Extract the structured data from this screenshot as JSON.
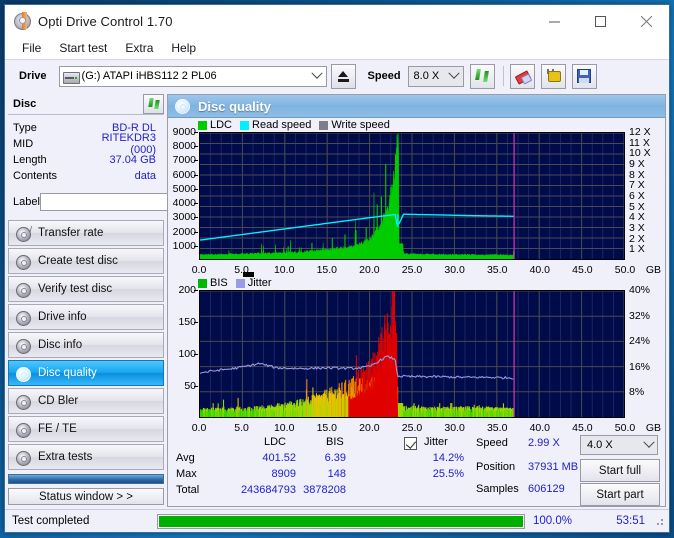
{
  "window": {
    "title": "Opti Drive Control 1.70",
    "app_icon": "disc-icon",
    "minimize": "minimize-icon",
    "maximize": "maximize-icon",
    "close": "close-icon"
  },
  "menu": {
    "items": [
      {
        "label": "File"
      },
      {
        "label": "Start test"
      },
      {
        "label": "Extra"
      },
      {
        "label": "Help"
      }
    ]
  },
  "toolbar": {
    "drive_label": "Drive",
    "drive_value": "(G:)  ATAPI iHBS112  2 PL06",
    "eject_icon": "eject-icon",
    "speed_label": "Speed",
    "speed_value": "8.0 X",
    "refresh_icon": "refresh-icon",
    "eraser_icon": "eraser-icon",
    "plug_icon": "plug-icon",
    "save_icon": "save-icon"
  },
  "disc": {
    "header": "Disc",
    "refresh_icon": "refresh-icon",
    "rows": [
      {
        "key": "Type",
        "value": "BD-R DL"
      },
      {
        "key": "MID",
        "value": "RITEKDR3 (000)"
      },
      {
        "key": "Length",
        "value": "37.04 GB"
      },
      {
        "key": "Contents",
        "value": "data"
      }
    ],
    "label_key": "Label",
    "label_value": "",
    "label_button_icon": "cd-icon"
  },
  "nav": {
    "items": [
      {
        "label": "Transfer rate",
        "icon": "disc-rate-icon",
        "selected": false
      },
      {
        "label": "Create test disc",
        "icon": "disc-create-icon",
        "selected": false
      },
      {
        "label": "Verify test disc",
        "icon": "disc-verify-icon",
        "selected": false
      },
      {
        "label": "Drive info",
        "icon": "disc-drive-icon",
        "selected": false
      },
      {
        "label": "Disc info",
        "icon": "disc-info-icon",
        "selected": false
      },
      {
        "label": "Disc quality",
        "icon": "disc-quality-icon",
        "selected": true
      },
      {
        "label": "CD Bler",
        "icon": "disc-bler-icon",
        "selected": false
      },
      {
        "label": "FE / TE",
        "icon": "disc-fete-icon",
        "selected": false
      },
      {
        "label": "Extra tests",
        "icon": "disc-extra-icon",
        "selected": false
      }
    ],
    "status_window_button": "Status window > >"
  },
  "panel": {
    "title": "Disc quality",
    "icon": "disc-quality-icon"
  },
  "stats": {
    "col_ldc": "LDC",
    "col_bis": "BIS",
    "row_avg": "Avg",
    "row_max": "Max",
    "row_total": "Total",
    "ldc_avg": "401.52",
    "ldc_max": "8909",
    "ldc_total": "243684793",
    "bis_avg": "6.39",
    "bis_max": "148",
    "bis_total": "3878208",
    "jitter_label": "Jitter",
    "jitter_checked": true,
    "jitter_avg": "14.2%",
    "jitter_max": "25.5%",
    "speed_label": "Speed",
    "speed_value": "2.99 X",
    "position_label": "Position",
    "position_value": "37931 MB",
    "samples_label": "Samples",
    "samples_value": "606129",
    "speed_select": "4.0 X",
    "start_full": "Start full",
    "start_part": "Start part"
  },
  "statusbar": {
    "text": "Test completed",
    "percent": "100.0%",
    "percent_value": 100,
    "elapsed": "53:51"
  },
  "colors": {
    "ldc_green": "#00cc00",
    "read_speed_cyan": "#00f0ff",
    "write_speed_gray": "#7e7e8a",
    "bis_green": "#00b800",
    "jitter_purple": "#9a9ae8",
    "bis_red": "#e00000",
    "plot_bg": "#000b4a",
    "marker_magenta": "#cc33aa",
    "accent_blue": "#17a6f0",
    "value_blue": "#2222cc",
    "progress_green": "#00b000"
  },
  "chart_data": [
    {
      "type": "area",
      "name": "ldc-chart",
      "title": "",
      "legend": [
        {
          "label": "LDC",
          "color": "#00cc00"
        },
        {
          "label": "Read speed",
          "color": "#00f0ff"
        },
        {
          "label": "Write speed",
          "color": "#7e7e8a"
        }
      ],
      "legend_position": "top-left",
      "xlabel": "GB",
      "ylabel": "",
      "ylim": [
        0,
        9000
      ],
      "yticks": [
        1000,
        2000,
        3000,
        4000,
        5000,
        6000,
        7000,
        8000,
        9000
      ],
      "y2lim": [
        0,
        12
      ],
      "y2ticks": [
        1,
        2,
        3,
        4,
        5,
        6,
        7,
        8,
        9,
        10,
        11,
        12
      ],
      "y2tick_labels": [
        "1 X",
        "2 X",
        "3 X",
        "4 X",
        "5 X",
        "6 X",
        "7 X",
        "8 X",
        "9 X",
        "10 X",
        "11 X",
        "12 X"
      ],
      "xlim": [
        0,
        50
      ],
      "xticks": [
        0.0,
        5.0,
        10.0,
        15.0,
        20.0,
        25.0,
        30.0,
        35.0,
        40.0,
        45.0,
        50.0
      ],
      "xtick_labels": [
        "0.0",
        "5.0",
        "10.0",
        "15.0",
        "20.0",
        "25.0",
        "30.0",
        "35.0",
        "40.0",
        "45.0",
        "50.0"
      ],
      "grid": true,
      "data_end_gb": 37.04,
      "marker_gb": 37.04,
      "series": [
        {
          "name": "LDC",
          "color": "#00cc00",
          "x": [
            0,
            1,
            2,
            3,
            4,
            5,
            6,
            7,
            8,
            9,
            10,
            11,
            12,
            13,
            14,
            15,
            16,
            17,
            18,
            19,
            20,
            20.5,
            21,
            21.5,
            22,
            22.5,
            23,
            23.2,
            23.4,
            23.6,
            24,
            25,
            26,
            27,
            28,
            29,
            30,
            31,
            32,
            33,
            34,
            35,
            36,
            37
          ],
          "y": [
            340,
            330,
            350,
            360,
            370,
            390,
            400,
            420,
            430,
            450,
            470,
            500,
            540,
            590,
            640,
            700,
            780,
            860,
            980,
            1150,
            1450,
            1800,
            2300,
            2900,
            3600,
            4600,
            6400,
            7500,
            8900,
            5200,
            420,
            380,
            360,
            350,
            340,
            330,
            320,
            330,
            320,
            310,
            315,
            320,
            310,
            300
          ]
        },
        {
          "name": "Read speed",
          "color": "#00f0ff",
          "x": [
            0,
            5,
            10,
            15,
            20,
            23,
            23.3,
            24,
            28,
            32,
            37
          ],
          "y": [
            1350,
            1750,
            2150,
            2550,
            2950,
            3180,
            2300,
            3200,
            3150,
            3100,
            3050
          ]
        }
      ]
    },
    {
      "type": "area",
      "name": "bis-chart",
      "title": "",
      "legend": [
        {
          "label": "BIS",
          "color": "#00b800"
        },
        {
          "label": "Jitter",
          "color": "#9a9ae8"
        }
      ],
      "legend_position": "top-left",
      "xlabel": "GB",
      "ylabel": "",
      "ylim": [
        0,
        200
      ],
      "yticks": [
        50,
        100,
        150,
        200
      ],
      "y2lim": [
        0,
        40
      ],
      "y2ticks": [
        8,
        16,
        24,
        32,
        40
      ],
      "y2tick_labels": [
        "8%",
        "16%",
        "24%",
        "32%",
        "40%"
      ],
      "xlim": [
        0,
        50
      ],
      "xticks": [
        0.0,
        5.0,
        10.0,
        15.0,
        20.0,
        25.0,
        30.0,
        35.0,
        40.0,
        45.0,
        50.0
      ],
      "xtick_labels": [
        "0.0",
        "5.0",
        "10.0",
        "15.0",
        "20.0",
        "25.0",
        "30.0",
        "35.0",
        "40.0",
        "45.0",
        "50.0"
      ],
      "grid": true,
      "data_end_gb": 37.04,
      "marker_gb": 37.04,
      "series": [
        {
          "name": "BIS",
          "color": "#00b800",
          "x": [
            0,
            2,
            4,
            6,
            8,
            10,
            12,
            14,
            16,
            18,
            20,
            21,
            22,
            23,
            23.3,
            24,
            26,
            28,
            30,
            32,
            34,
            36,
            37
          ],
          "y": [
            10,
            10,
            11,
            12,
            13,
            16,
            20,
            26,
            34,
            44,
            62,
            85,
            115,
            148,
            60,
            12,
            12,
            11,
            11,
            12,
            11,
            10,
            10
          ]
        },
        {
          "name": "Jitter",
          "color": "#9a9ae8",
          "x": [
            0,
            2,
            4,
            6,
            7,
            9,
            12,
            15,
            18,
            20,
            21,
            22,
            23,
            23.3,
            25,
            28,
            31,
            34,
            37
          ],
          "y": [
            70,
            74,
            77,
            82,
            85,
            78,
            77,
            78,
            77,
            80,
            88,
            96,
            92,
            65,
            64,
            64,
            63,
            63,
            62
          ]
        }
      ]
    }
  ]
}
